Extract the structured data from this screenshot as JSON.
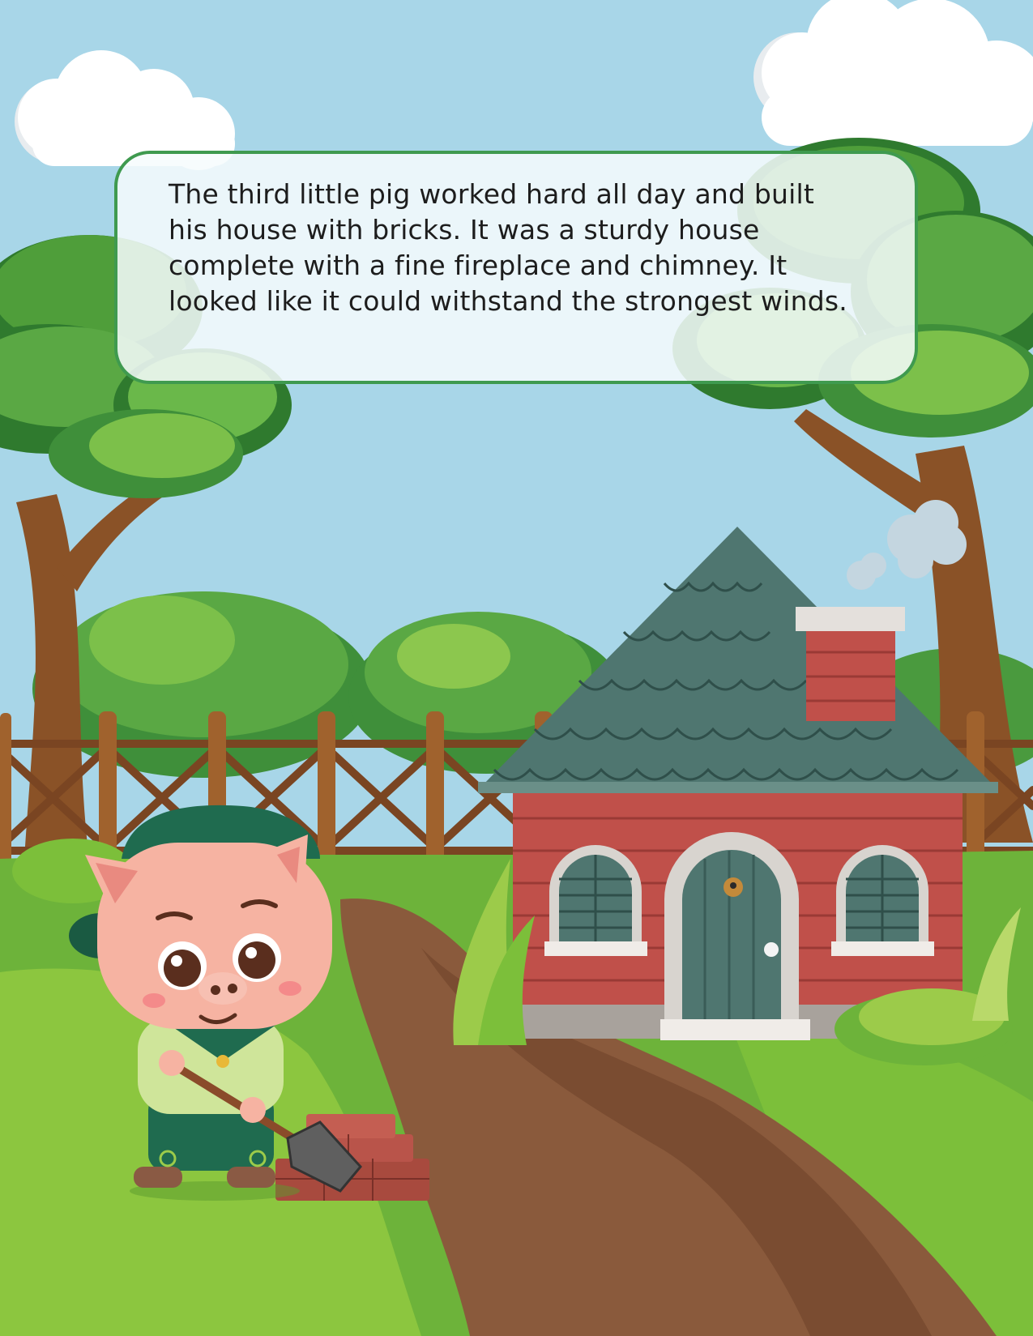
{
  "page": {
    "story_text": "The third little pig worked hard all day and built his house with bricks. It was a sturdy house complete with a fine fireplace and chimney. It looked like it could withstand the strongest winds."
  },
  "colors": {
    "sky": "#a8d6e8",
    "grass": "#7cbf3a",
    "path": "#8a5a3c",
    "brick": "#c0504a",
    "roof": "#4f7670",
    "door": "#4f7670",
    "pig": "#f6b3a2",
    "pig_outfit": "#1f6b4f",
    "box_border": "#3f9a4f"
  },
  "illustration": {
    "subjects": [
      "pig-character",
      "brick-house",
      "chimney-smoke",
      "shovel",
      "brick-pile",
      "wooden-fence",
      "trees",
      "clouds",
      "dirt-path"
    ]
  }
}
